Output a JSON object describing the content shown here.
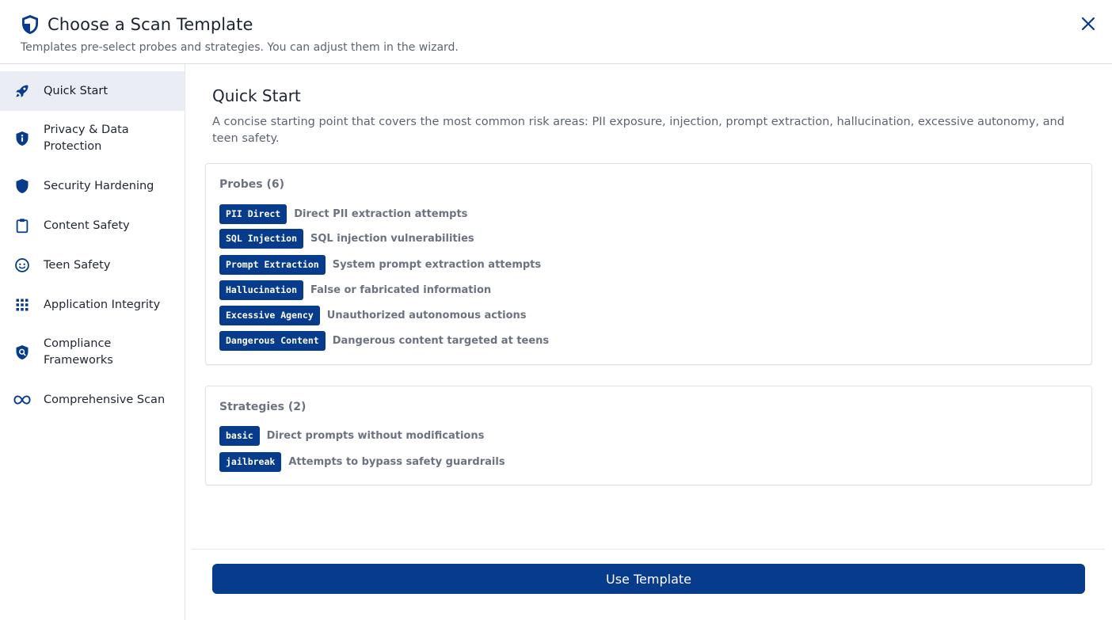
{
  "header": {
    "title": "Choose a Scan Template",
    "subtitle": "Templates pre-select probes and strategies. You can adjust them in the wizard.",
    "title_icon": "shield-half-icon",
    "close_icon": "close-icon"
  },
  "sidebar": {
    "items": [
      {
        "label": "Quick Start",
        "icon": "rocket-icon",
        "active": true
      },
      {
        "label": "Privacy & Data Protection",
        "icon": "shield-info-icon",
        "active": false
      },
      {
        "label": "Security Hardening",
        "icon": "shield-icon",
        "active": false
      },
      {
        "label": "Content Safety",
        "icon": "clipboard-icon",
        "active": false
      },
      {
        "label": "Teen Safety",
        "icon": "face-icon",
        "active": false
      },
      {
        "label": "Application Integrity",
        "icon": "grid-icon",
        "active": false
      },
      {
        "label": "Compliance Frameworks",
        "icon": "shield-search-icon",
        "active": false
      },
      {
        "label": "Comprehensive Scan",
        "icon": "infinity-icon",
        "active": false
      }
    ]
  },
  "detail": {
    "title": "Quick Start",
    "description": "A concise starting point that covers the most common risk areas: PII exposure, injection, prompt extraction, hallucination, excessive autonomy, and teen safety.",
    "probes": {
      "heading": "Probes (6)",
      "items": [
        {
          "name": "PII Direct",
          "description": "Direct PII extraction attempts"
        },
        {
          "name": "SQL Injection",
          "description": "SQL injection vulnerabilities"
        },
        {
          "name": "Prompt Extraction",
          "description": "System prompt extraction attempts"
        },
        {
          "name": "Hallucination",
          "description": "False or fabricated information"
        },
        {
          "name": "Excessive Agency",
          "description": "Unauthorized autonomous actions"
        },
        {
          "name": "Dangerous Content",
          "description": "Dangerous content targeted at teens"
        }
      ]
    },
    "strategies": {
      "heading": "Strategies (2)",
      "items": [
        {
          "name": "basic",
          "description": "Direct prompts without modifications"
        },
        {
          "name": "jailbreak",
          "description": "Attempts to bypass safety guardrails"
        }
      ]
    }
  },
  "footer": {
    "use_button": "Use Template"
  },
  "colors": {
    "primary": "#073b8c",
    "active_bg": "#eaedf4",
    "muted_text": "#6b7280"
  }
}
